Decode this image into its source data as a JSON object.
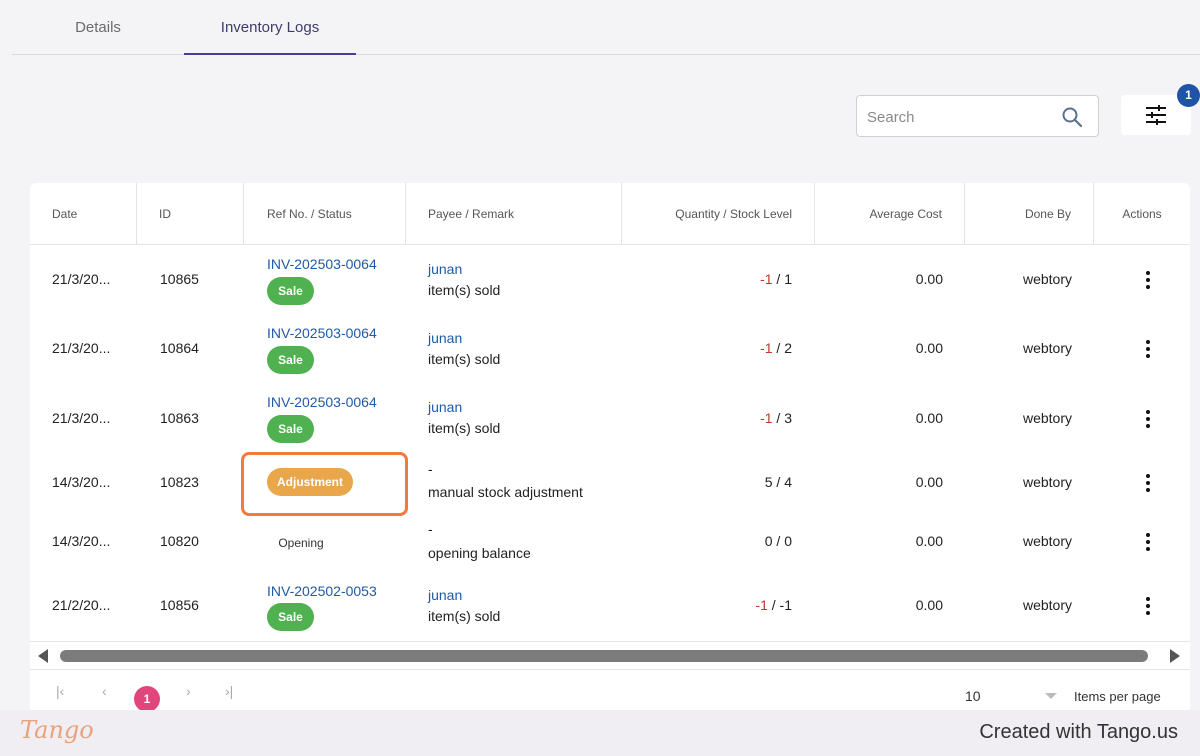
{
  "tabs": [
    {
      "label": "Details",
      "active": false
    },
    {
      "label": "Inventory Logs",
      "active": true
    }
  ],
  "search": {
    "placeholder": "Search"
  },
  "filter": {
    "badge_count": "1"
  },
  "table": {
    "columns": [
      "Date",
      "ID",
      "Ref No. / Status",
      "Payee / Remark",
      "Quantity / Stock Level",
      "Average Cost",
      "Done By",
      "Actions"
    ],
    "rows": [
      {
        "date": "21/3/20...",
        "id": "10865",
        "ref": "INV-202503-0064",
        "status": "Sale",
        "payee": "junan",
        "remark": "item(s) sold",
        "qty_change": "-1",
        "stock": "1",
        "avg_cost": "0.00",
        "done_by": "webtory"
      },
      {
        "date": "21/3/20...",
        "id": "10864",
        "ref": "INV-202503-0064",
        "status": "Sale",
        "payee": "junan",
        "remark": "item(s) sold",
        "qty_change": "-1",
        "stock": "2",
        "avg_cost": "0.00",
        "done_by": "webtory"
      },
      {
        "date": "21/3/20...",
        "id": "10863",
        "ref": "INV-202503-0064",
        "status": "Sale",
        "payee": "junan",
        "remark": "item(s) sold",
        "qty_change": "-1",
        "stock": "3",
        "avg_cost": "0.00",
        "done_by": "webtory"
      },
      {
        "date": "14/3/20...",
        "id": "10823",
        "ref": "",
        "status": "Adjustment",
        "payee": "-",
        "remark": "manual stock adjustment",
        "qty_change": "5",
        "stock": "4",
        "avg_cost": "0.00",
        "done_by": "webtory"
      },
      {
        "date": "14/3/20...",
        "id": "10820",
        "ref": "",
        "status": "Opening",
        "payee": "-",
        "remark": "opening balance",
        "qty_change": "0",
        "stock": "0",
        "avg_cost": "0.00",
        "done_by": "webtory"
      },
      {
        "date": "21/2/20...",
        "id": "10856",
        "ref": "INV-202502-0053",
        "status": "Sale",
        "payee": "junan",
        "remark": "item(s) sold",
        "qty_change": "-1",
        "stock": "-1",
        "avg_cost": "0.00",
        "done_by": "webtory"
      }
    ]
  },
  "pagination": {
    "current_page": "1",
    "items_per_page": "10",
    "items_per_page_label": "Items per page"
  },
  "footer": {
    "logo": "Tango",
    "credit": "Created with Tango.us"
  },
  "colors": {
    "accent": "#4a3f8f",
    "link": "#1e5aa8",
    "sale": "#4fb14f",
    "adjustment": "#eaa64a",
    "page_active": "#e0457b",
    "badge": "#1e53a6",
    "highlight": "#f27a3a"
  },
  "icons": {
    "search": "search-icon",
    "filter": "sliders-icon",
    "actions": "kebab-menu-icon"
  }
}
